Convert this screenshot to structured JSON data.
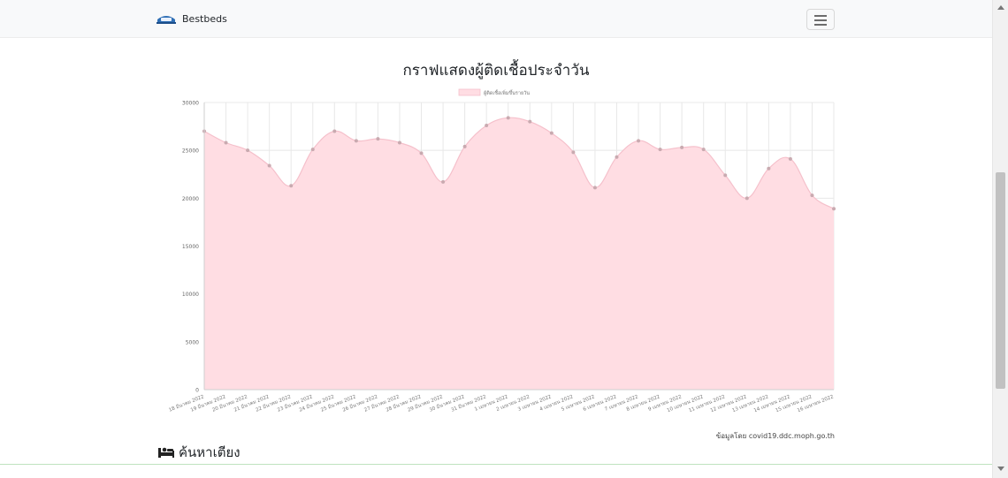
{
  "navbar": {
    "brand_label": "Bestbeds",
    "brand_icon": "bed-icon",
    "menu_icon": "hamburger-menu-icon"
  },
  "page_title": "กราฟแสดงผู้ติดเชื้อประจำวัน",
  "source_text": "ข้อมูลโดย covid19.ddc.moph.go.th",
  "search_heading": "ค้นหาเตียง",
  "search_icon": "bed-search-icon",
  "colors": {
    "area_fill": "#ffdde3",
    "area_stroke": "#f5c0cb",
    "point": "#c9aab0",
    "grid": "#e8e8e8"
  },
  "chart_data": {
    "type": "area",
    "legend": "top",
    "grid": true,
    "ylim": [
      0,
      30000
    ],
    "yticks": [
      "0",
      "5000",
      "10000",
      "15000",
      "20000",
      "25000",
      "30000"
    ],
    "categories": [
      "18 มีนาคม 2022",
      "19 มีนาคม 2022",
      "20 มีนาคม 2022",
      "21 มีนาคม 2022",
      "22 มีนาคม 2022",
      "23 มีนาคม 2022",
      "24 มีนาคม 2022",
      "25 มีนาคม 2022",
      "26 มีนาคม 2022",
      "27 มีนาคม 2022",
      "28 มีนาคม 2022",
      "29 มีนาคม 2022",
      "30 มีนาคม 2022",
      "31 มีนาคม 2022",
      "1 เมษายน 2022",
      "2 เมษายน 2022",
      "3 เมษายน 2022",
      "4 เมษายน 2022",
      "5 เมษายน 2022",
      "6 เมษายน 2022",
      "7 เมษายน 2022",
      "8 เมษายน 2022",
      "9 เมษายน 2022",
      "10 เมษายน 2022",
      "11 เมษายน 2022",
      "12 เมษายน 2022",
      "13 เมษายน 2022",
      "14 เมษายน 2022",
      "15 เมษายน 2022",
      "16 เมษายน 2022"
    ],
    "series": [
      {
        "name": "ผู้ติดเชื้อเพิ่มขึ้นรายวัน",
        "values": [
          27000,
          25800,
          25000,
          23400,
          21300,
          25100,
          27000,
          26000,
          26200,
          25800,
          24700,
          21700,
          25400,
          27600,
          28400,
          28000,
          26800,
          24800,
          21100,
          24300,
          26000,
          25100,
          25300,
          25100,
          22400,
          20000,
          23100,
          24100,
          20300,
          18900
        ]
      }
    ]
  }
}
